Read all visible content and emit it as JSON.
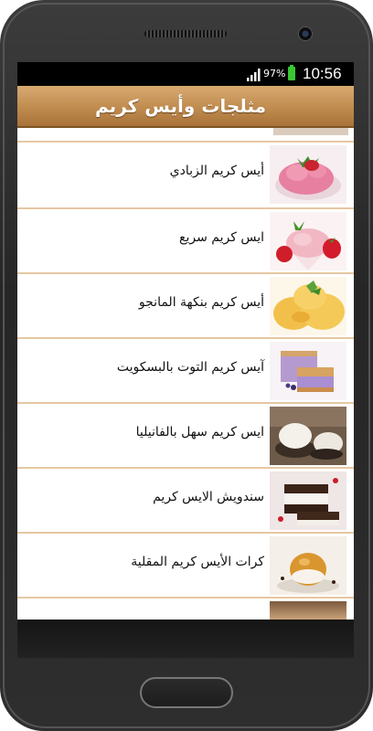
{
  "status_bar": {
    "battery_percent": "97%",
    "time": "10:56",
    "icons": [
      "signal-icon",
      "battery-icon"
    ],
    "battery_color": "#39c733"
  },
  "action_bar": {
    "title": "مثلجات وأيس كريم",
    "color": "#c08b4e"
  },
  "list": {
    "items": [
      {
        "label": "أيس كريم الزبادي",
        "thumb": "strawberry-yogurt-ice-cream-image"
      },
      {
        "label": "ايس كريم سريع",
        "thumb": "strawberry-ice-cream-image"
      },
      {
        "label": "أيس كريم بنكهة المانجو",
        "thumb": "mango-ice-cream-image"
      },
      {
        "label": "آيس كريم التوت بالبسكويت",
        "thumb": "berry-biscuit-ice-cream-image"
      },
      {
        "label": "ايس كريم سهل بالفانيليا",
        "thumb": "vanilla-ice-cream-image"
      },
      {
        "label": "سندويش الايس كريم",
        "thumb": "ice-cream-sandwich-image"
      },
      {
        "label": "كرات الأيس كريم المقلية",
        "thumb": "fried-ice-cream-balls-image"
      }
    ]
  }
}
